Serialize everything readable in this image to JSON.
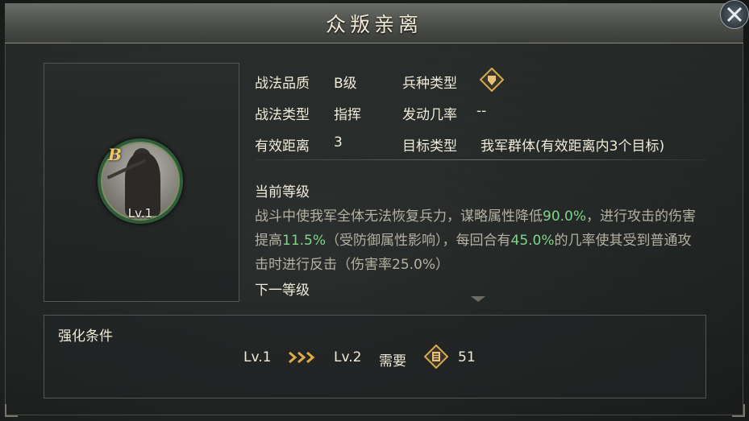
{
  "title": "众叛亲离",
  "portrait": {
    "grade": "B",
    "level": "Lv.1"
  },
  "info": {
    "quality_label": "战法品质",
    "quality_value": "B级",
    "troop_label": "兵种类型",
    "troop_icon": "shield-icon",
    "type_label": "战法类型",
    "type_value": "指挥",
    "trigger_label": "发动几率",
    "trigger_value": "--",
    "range_label": "有效距离",
    "range_value": "3",
    "target_label": "目标类型",
    "target_value": "我军群体(有效距离内3个目标)"
  },
  "current_level": {
    "heading": "当前等级",
    "desc_part1": "战斗中使我军全体无法恢复兵力，谋略属性降低",
    "desc_hl1": "90.0%",
    "desc_part2": "，进行攻击的伤害提高",
    "desc_hl2": "11.5%",
    "desc_part3": "（受防御属性影响），每回合有",
    "desc_hl3": "45.0%",
    "desc_part4": "的几率使其受到普通攻击时进行反击（伤害率25.0%）"
  },
  "next_level": {
    "heading": "下一等级"
  },
  "enhance": {
    "heading": "强化条件",
    "from_level": "Lv.1",
    "to_level": "Lv.2",
    "require_label": "需要",
    "cost_icon": "skill-point-icon",
    "cost_value": "51"
  },
  "colors": {
    "highlight": "#7fd68a",
    "accent_gold": "#e0a94a"
  }
}
